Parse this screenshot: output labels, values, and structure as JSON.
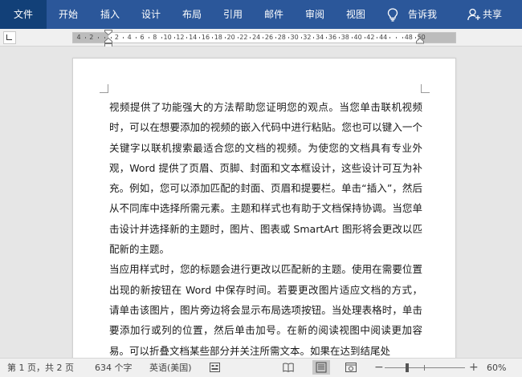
{
  "ribbon": {
    "tabs": [
      "文件",
      "开始",
      "插入",
      "设计",
      "布局",
      "引用",
      "邮件",
      "审阅",
      "视图"
    ],
    "tell_me": "告诉我",
    "share": "共享"
  },
  "ruler": {
    "numbers": [
      "4",
      "2",
      "",
      "2",
      "4",
      "6",
      "8",
      "10",
      "12",
      "14",
      "16",
      "18",
      "20",
      "22",
      "24",
      "26",
      "28",
      "30",
      "32",
      "34",
      "36",
      "38",
      "40",
      "42",
      "44",
      "",
      "48",
      "50"
    ]
  },
  "document": {
    "paragraphs": [
      "视频提供了功能强大的方法帮助您证明您的观点。当您单击联机视频时，可以在想要添加的视频的嵌入代码中进行粘贴。您也可以键入一个关键字以联机搜索最适合您的文档的视频。为使您的文档具有专业外观，Word 提供了页眉、页脚、封面和文本框设计，这些设计可互为补充。例如，您可以添加匹配的封面、页眉和提要栏。单击“插入”，然后从不同库中选择所需元素。主题和样式也有助于文档保持协调。当您单击设计并选择新的主题时，图片、图表或 SmartArt 图形将会更改以匹配新的主题。",
      "当应用样式时，您的标题会进行更改以匹配新的主题。使用在需要位置出现的新按钮在 Word 中保存时间。若要更改图片适应文档的方式，请单击该图片，图片旁边将会显示布局选项按钮。当处理表格时，单击要添加行或列的位置，然后单击加号。在新的阅读视图中阅读更加容易。可以折叠文档某些部分并关注所需文本。如果在达到结尾处"
    ]
  },
  "status_bar": {
    "page": "第 1 页，共 2 页",
    "words": "634 个字",
    "language": "英语(美国)",
    "zoom_minus": "−",
    "zoom_plus": "+",
    "zoom": "60%",
    "zoom_level_percent": 60
  },
  "colors": {
    "ribbon": "#2b579a",
    "ribbon_active_tab": "#124078",
    "workspace": "#e6e6e6"
  }
}
